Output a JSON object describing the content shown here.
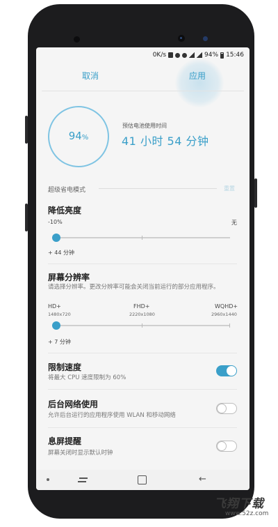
{
  "status_bar": {
    "text": "0K/s",
    "battery": "94%",
    "time": "15:46"
  },
  "header": {
    "cancel": "取消",
    "apply": "应用"
  },
  "battery_summary": {
    "percent": "94",
    "percent_unit": "%",
    "estimate_label": "预估电池使用时间",
    "estimate_value": "41 小时 54 分钟"
  },
  "mode_section": {
    "title": "超级省电模式",
    "reset": "重置"
  },
  "brightness": {
    "title": "降低亮度",
    "min_label": "-10%",
    "max_label": "无",
    "gain": "+ 44 分钟",
    "level": 0
  },
  "resolution": {
    "title": "屏幕分辨率",
    "desc": "请选择分辨率。更改分辨率可能会关闭当前运行的部分应用程序。",
    "options": [
      {
        "name": "HD+",
        "size": "1480x720"
      },
      {
        "name": "FHD+",
        "size": "2220x1080"
      },
      {
        "name": "WQHD+",
        "size": "2960x1440"
      }
    ],
    "selected_index": 0,
    "gain": "+ 7 分钟"
  },
  "limit_speed": {
    "title": "限制速度",
    "desc": "将最大 CPU 速度限制为 60%",
    "on": true
  },
  "background_network": {
    "title": "后台网络使用",
    "desc": "允许后台运行的应用程序使用 WLAN 和移动网络",
    "on": false
  },
  "screen_off": {
    "title": "息屏提醒",
    "desc": "屏幕关闭时显示默认时钟",
    "on": false
  },
  "watermark": {
    "logo": "飞翔下载",
    "url": "www.52z.com"
  },
  "colors": {
    "accent": "#3a9fc9",
    "phone_frame": "#1c1c1e",
    "screen_bg": "#f5f5f5"
  }
}
